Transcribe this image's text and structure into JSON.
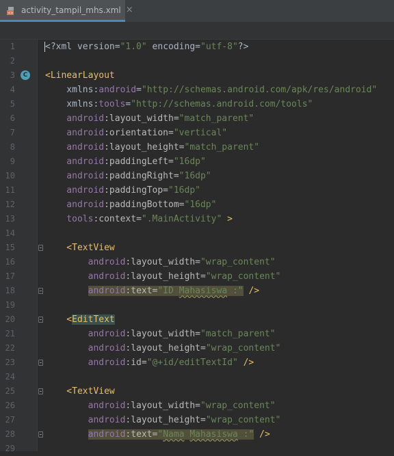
{
  "tab": {
    "title": "activity_tampil_mhs.xml",
    "close": "×"
  },
  "code": {
    "lines": [
      {
        "n": "1",
        "parts": [
          {
            "c": "t-plain",
            "t": "<?xml version="
          },
          {
            "c": "t-val",
            "t": "\"1.0\""
          },
          {
            "c": "t-plain",
            "t": " encoding="
          },
          {
            "c": "t-val",
            "t": "\"utf-8\""
          },
          {
            "c": "t-plain",
            "t": "?>"
          }
        ]
      },
      {
        "n": "2",
        "parts": []
      },
      {
        "n": "3",
        "badge": "C",
        "parts": [
          {
            "c": "t-tag",
            "t": "<LinearLayout"
          }
        ]
      },
      {
        "n": "4",
        "parts": [
          {
            "c": "t-plain",
            "t": "    xmlns:"
          },
          {
            "c": "t-ns",
            "t": "android"
          },
          {
            "c": "t-plain",
            "t": "="
          },
          {
            "c": "t-val",
            "t": "\"http://schemas.android.com/apk/res/android\""
          }
        ]
      },
      {
        "n": "5",
        "parts": [
          {
            "c": "t-plain",
            "t": "    xmlns:"
          },
          {
            "c": "t-ns",
            "t": "tools"
          },
          {
            "c": "t-plain",
            "t": "="
          },
          {
            "c": "t-val",
            "t": "\"http://schemas.android.com/tools\""
          }
        ]
      },
      {
        "n": "6",
        "parts": [
          {
            "c": "t-ns",
            "t": "    android"
          },
          {
            "c": "t-attr",
            "t": ":layout_width="
          },
          {
            "c": "t-val",
            "t": "\"match_parent\""
          }
        ]
      },
      {
        "n": "7",
        "parts": [
          {
            "c": "t-ns",
            "t": "    android"
          },
          {
            "c": "t-attr",
            "t": ":orientation="
          },
          {
            "c": "t-val",
            "t": "\"vertical\""
          }
        ]
      },
      {
        "n": "8",
        "parts": [
          {
            "c": "t-ns",
            "t": "    android"
          },
          {
            "c": "t-attr",
            "t": ":layout_height="
          },
          {
            "c": "t-val",
            "t": "\"match_parent\""
          }
        ]
      },
      {
        "n": "9",
        "parts": [
          {
            "c": "t-ns",
            "t": "    android"
          },
          {
            "c": "t-attr",
            "t": ":paddingLeft="
          },
          {
            "c": "t-val",
            "t": "\"16dp\""
          }
        ]
      },
      {
        "n": "10",
        "parts": [
          {
            "c": "t-ns",
            "t": "    android"
          },
          {
            "c": "t-attr",
            "t": ":paddingRight="
          },
          {
            "c": "t-val",
            "t": "\"16dp\""
          }
        ]
      },
      {
        "n": "11",
        "parts": [
          {
            "c": "t-ns",
            "t": "    android"
          },
          {
            "c": "t-attr",
            "t": ":paddingTop="
          },
          {
            "c": "t-val",
            "t": "\"16dp\""
          }
        ]
      },
      {
        "n": "12",
        "parts": [
          {
            "c": "t-ns",
            "t": "    android"
          },
          {
            "c": "t-attr",
            "t": ":paddingBottom="
          },
          {
            "c": "t-val",
            "t": "\"16dp\""
          }
        ]
      },
      {
        "n": "13",
        "parts": [
          {
            "c": "t-ns",
            "t": "    tools"
          },
          {
            "c": "t-attr",
            "t": ":context="
          },
          {
            "c": "t-val",
            "t": "\".MainActivity\""
          },
          {
            "c": "t-tag",
            "t": " >"
          }
        ]
      },
      {
        "n": "14",
        "parts": []
      },
      {
        "n": "15",
        "fold": true,
        "parts": [
          {
            "c": "t-tag",
            "t": "    <TextView"
          }
        ]
      },
      {
        "n": "16",
        "parts": [
          {
            "c": "t-ns",
            "t": "        android"
          },
          {
            "c": "t-attr",
            "t": ":layout_width="
          },
          {
            "c": "t-val",
            "t": "\"wrap_content\""
          }
        ]
      },
      {
        "n": "17",
        "parts": [
          {
            "c": "t-ns",
            "t": "        android"
          },
          {
            "c": "t-attr",
            "t": ":layout_height="
          },
          {
            "c": "t-val",
            "t": "\"wrap_content\""
          }
        ]
      },
      {
        "n": "18",
        "fold": true,
        "parts": [
          {
            "c": "t-plain",
            "t": "        "
          },
          {
            "c": "t-ns hl",
            "t": "android"
          },
          {
            "c": "t-attr hl",
            "t": ":text="
          },
          {
            "c": "t-val hl",
            "t": "\"ID "
          },
          {
            "c": "t-val hl squig",
            "t": "Mahasiswa"
          },
          {
            "c": "t-val hl",
            "t": " :\""
          },
          {
            "c": "t-tag",
            "t": " />"
          }
        ]
      },
      {
        "n": "19",
        "parts": []
      },
      {
        "n": "20",
        "fold": true,
        "parts": [
          {
            "c": "t-tag",
            "t": "    <"
          },
          {
            "c": "t-tag sel",
            "t": "EditText"
          }
        ]
      },
      {
        "n": "21",
        "parts": [
          {
            "c": "t-ns",
            "t": "        android"
          },
          {
            "c": "t-attr",
            "t": ":layout_width="
          },
          {
            "c": "t-val",
            "t": "\"match_parent\""
          }
        ]
      },
      {
        "n": "22",
        "parts": [
          {
            "c": "t-ns",
            "t": "        android"
          },
          {
            "c": "t-attr",
            "t": ":layout_height="
          },
          {
            "c": "t-val",
            "t": "\"wrap_content\""
          }
        ]
      },
      {
        "n": "23",
        "fold": true,
        "parts": [
          {
            "c": "t-ns",
            "t": "        android"
          },
          {
            "c": "t-attr",
            "t": ":id="
          },
          {
            "c": "t-val",
            "t": "\"@+id/editTextId\""
          },
          {
            "c": "t-tag",
            "t": " />"
          }
        ]
      },
      {
        "n": "24",
        "parts": []
      },
      {
        "n": "25",
        "fold": true,
        "parts": [
          {
            "c": "t-tag",
            "t": "    <TextView"
          }
        ]
      },
      {
        "n": "26",
        "parts": [
          {
            "c": "t-ns",
            "t": "        android"
          },
          {
            "c": "t-attr",
            "t": ":layout_width="
          },
          {
            "c": "t-val",
            "t": "\"wrap_content\""
          }
        ]
      },
      {
        "n": "27",
        "parts": [
          {
            "c": "t-ns",
            "t": "        android"
          },
          {
            "c": "t-attr",
            "t": ":layout_height="
          },
          {
            "c": "t-val",
            "t": "\"wrap_content\""
          }
        ]
      },
      {
        "n": "28",
        "fold": true,
        "parts": [
          {
            "c": "t-plain",
            "t": "        "
          },
          {
            "c": "t-ns hl",
            "t": "android"
          },
          {
            "c": "t-attr hl",
            "t": ":text="
          },
          {
            "c": "t-val hl",
            "t": "\""
          },
          {
            "c": "t-val hl squig",
            "t": "Nama"
          },
          {
            "c": "t-val hl",
            "t": " "
          },
          {
            "c": "t-val hl squig",
            "t": "Mahasiswa"
          },
          {
            "c": "t-val hl",
            "t": " :\""
          },
          {
            "c": "t-tag",
            "t": " />"
          }
        ]
      },
      {
        "n": "29",
        "parts": []
      }
    ]
  },
  "colors": {
    "background": "#2b2b2b",
    "tag": "#e8bf6a",
    "namespace": "#9876aa",
    "value": "#6a8759",
    "attribute": "#bababa"
  },
  "icons": {
    "file": "xml-file-icon",
    "class_badge": "class-c-icon",
    "fold": "fold-marker-icon"
  }
}
